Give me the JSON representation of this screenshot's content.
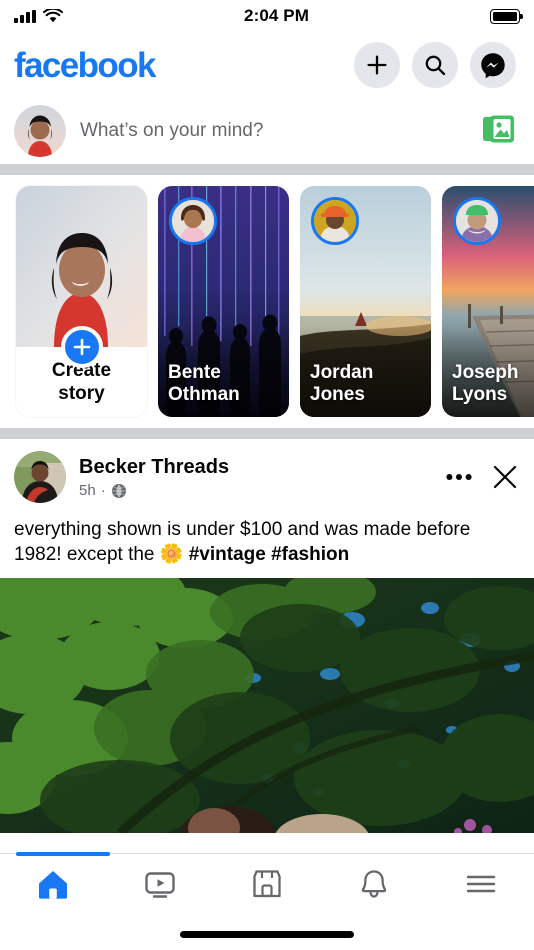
{
  "status_bar": {
    "time": "2:04 PM",
    "signal_icon": "cellular-signal-icon",
    "wifi_icon": "wifi-icon",
    "battery_icon": "battery-full-icon"
  },
  "header": {
    "wordmark": "facebook",
    "brand_color": "#1877F2",
    "actions": [
      {
        "name": "create-button",
        "icon": "plus-icon"
      },
      {
        "name": "search-button",
        "icon": "search-icon"
      },
      {
        "name": "messenger-button",
        "icon": "messenger-icon"
      }
    ]
  },
  "composer": {
    "placeholder": "What’s on your mind?",
    "avatar": "user-avatar",
    "photo_icon": "photos-icon",
    "photo_icon_color": "#45BD62"
  },
  "stories": {
    "create": {
      "label_line1": "Create",
      "label_line2": "story",
      "plus_icon": "plus-icon"
    },
    "items": [
      {
        "name_line1": "Bente",
        "name_line2": "Othman",
        "ring_color": "#1877F2"
      },
      {
        "name_line1": "Jordan",
        "name_line2": "Jones",
        "ring_color": "#1877F2"
      },
      {
        "name_line1": "Joseph",
        "name_line2": "Lyons",
        "ring_color": "#1877F2"
      }
    ]
  },
  "post": {
    "author": "Becker Threads",
    "time": "5h",
    "separator": "·",
    "audience_icon": "globe-public-icon",
    "menu_icon": "more-options-icon",
    "close_icon": "close-icon",
    "text_plain": "everything shown is under $100 and was made before 1982! except the ",
    "emoji": "🌼",
    "hashtags": "#vintage #fashion",
    "media": "tree-canopy-photo"
  },
  "tabbar": {
    "active_index": 0,
    "active_color": "#1877F2",
    "inactive_color": "#65676B",
    "items": [
      {
        "name": "tab-home",
        "icon": "home-icon"
      },
      {
        "name": "tab-video",
        "icon": "video-icon"
      },
      {
        "name": "tab-marketplace",
        "icon": "marketplace-icon"
      },
      {
        "name": "tab-notifications",
        "icon": "bell-icon"
      },
      {
        "name": "tab-menu",
        "icon": "hamburger-menu-icon"
      }
    ],
    "home_indicator": "home-indicator-bar"
  }
}
